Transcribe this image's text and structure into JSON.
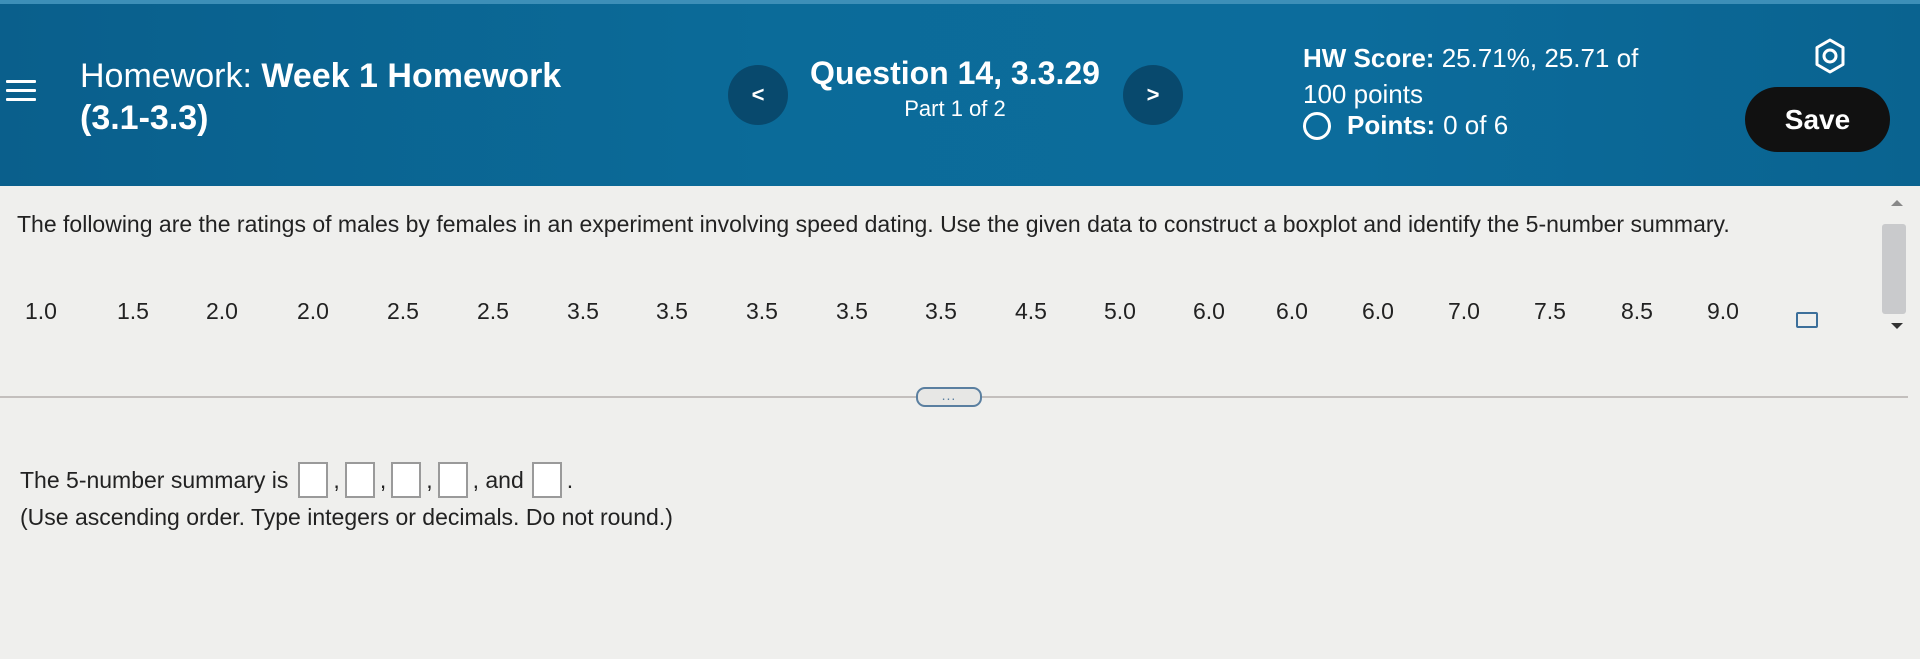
{
  "header": {
    "hw_prefix": "Homework:",
    "hw_name": "Week 1 Homework",
    "hw_range": "(3.1-3.3)",
    "prev_label": "<",
    "next_label": ">",
    "question_title": "Question 14, 3.3.29",
    "question_part": "Part 1 of 2",
    "score_label": "HW Score:",
    "score_value": "25.71%, 25.71 of",
    "score_line2": "100 points",
    "points_label": "Points:",
    "points_value": "0 of 6",
    "save_label": "Save"
  },
  "question": {
    "text": "The following are the ratings of males by females in an experiment involving speed dating. Use the given data to construct a boxplot and identify the 5-number summary.",
    "data": [
      "1.0",
      "1.5",
      "2.0",
      "2.0",
      "2.5",
      "2.5",
      "3.5",
      "3.5",
      "3.5",
      "3.5",
      "3.5",
      "4.5",
      "5.0",
      "6.0",
      "6.0",
      "6.0",
      "7.0",
      "7.5",
      "8.5",
      "9.0"
    ]
  },
  "more_label": "...",
  "answer": {
    "prefix": "The 5-number summary is",
    "sep": ",",
    "and_label": ", and",
    "end": ".",
    "hint": "(Use ascending order. Type integers or decimals. Do not round.)"
  },
  "colors": {
    "header_bg": "#0b6b99",
    "nav_button": "#08496d",
    "save_button": "#111111",
    "link_blue": "#3c6f9a"
  },
  "icons": [
    "hamburger-menu-icon",
    "chevron-left-icon",
    "chevron-right-icon",
    "radio-circle-icon",
    "gear-icon",
    "copy-data-icon",
    "scroll-up-icon",
    "scroll-down-icon"
  ]
}
